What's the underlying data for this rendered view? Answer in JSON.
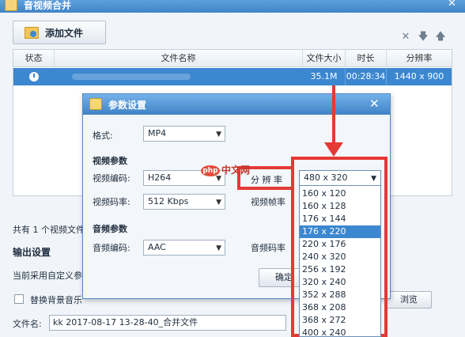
{
  "window": {
    "title": "音视频合并",
    "close_glyph": "✕"
  },
  "toolbar": {
    "add_file_label": "添加文件",
    "icons": [
      "close-icon",
      "arrow-down-icon",
      "arrow-up-icon"
    ]
  },
  "table": {
    "headers": [
      "状态",
      "文件名称",
      "文件大小",
      "时长",
      "分辨率"
    ],
    "rows": [
      {
        "name": "",
        "size": "35.1M",
        "duration": "00:28:34",
        "resolution": "1440 x 900"
      }
    ]
  },
  "main": {
    "summary": "共有 1 个视频文件",
    "output_title": "输出设置",
    "current_setting": "当前采用自定义参数",
    "bg_music_label": "替换背景音乐",
    "filename_label": "文件名:",
    "filename_value": "kk 2017-08-17 13-28-40_合并文件",
    "browse_label": "浏览"
  },
  "dialog": {
    "title": "参数设置",
    "close_glyph": "✕",
    "format_label": "格式:",
    "format_value": "MP4",
    "video_section": "视频参数",
    "video_codec_label": "视频编码:",
    "video_codec_value": "H264",
    "video_bitrate_label": "视频码率:",
    "video_bitrate_value": "512 Kbps",
    "resolution_label": "分 辨 率",
    "framerate_label": "视频帧率",
    "audio_section": "音频参数",
    "audio_codec_label": "音频编码:",
    "audio_codec_value": "AAC",
    "audio_bitrate_label": "音频码率",
    "confirm_label": "确定"
  },
  "resolution_dropdown": {
    "selected": "480 x 320",
    "options": [
      "160 x 120",
      "160 x 128",
      "176 x 144",
      "176 x 220",
      "220 x 176",
      "240 x 320",
      "256 x 192",
      "320 x 240",
      "352 x 288",
      "368 x 208",
      "368 x 272",
      "400 x 240"
    ],
    "highlighted": "176 x 220"
  },
  "watermark": {
    "badge": "php",
    "text": "中文网"
  },
  "colors": {
    "accent": "#3b87d0",
    "annotation": "#e53935"
  }
}
